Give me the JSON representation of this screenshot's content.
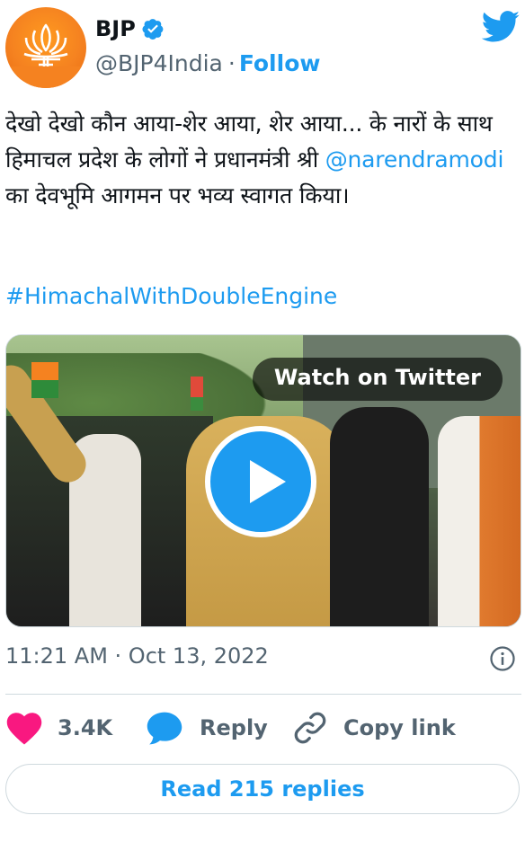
{
  "account": {
    "name": "BJP",
    "handle": "@BJP4India",
    "separator": "·",
    "follow_label": "Follow"
  },
  "tweet": {
    "text_part1": "देखो देखो कौन आया-शेर आया, शेर आया... के नारों के साथ हिमाचल प्रदेश के लोगों ने प्रधानमंत्री श्री ",
    "mention": "@narendramodi",
    "text_part2": " का देवभूमि आगमन पर भव्य स्वागत किया।",
    "hashtag": "#HimachalWithDoubleEngine"
  },
  "media": {
    "watch_label": "Watch on Twitter",
    "type": "video"
  },
  "meta": {
    "timestamp": "11:21 AM · Oct 13, 2022"
  },
  "actions": {
    "like_count": "3.4K",
    "reply_label": "Reply",
    "copy_link_label": "Copy link",
    "read_replies_label": "Read 215 replies"
  },
  "colors": {
    "accent": "#1d9bf0",
    "like": "#f91880",
    "text": "#0f1419",
    "secondary_text": "#536471",
    "border": "#cfd9de"
  },
  "icons": [
    "verified-badge-icon",
    "twitter-bird-icon",
    "play-icon",
    "info-icon",
    "heart-icon",
    "reply-bubble-icon",
    "link-icon"
  ]
}
